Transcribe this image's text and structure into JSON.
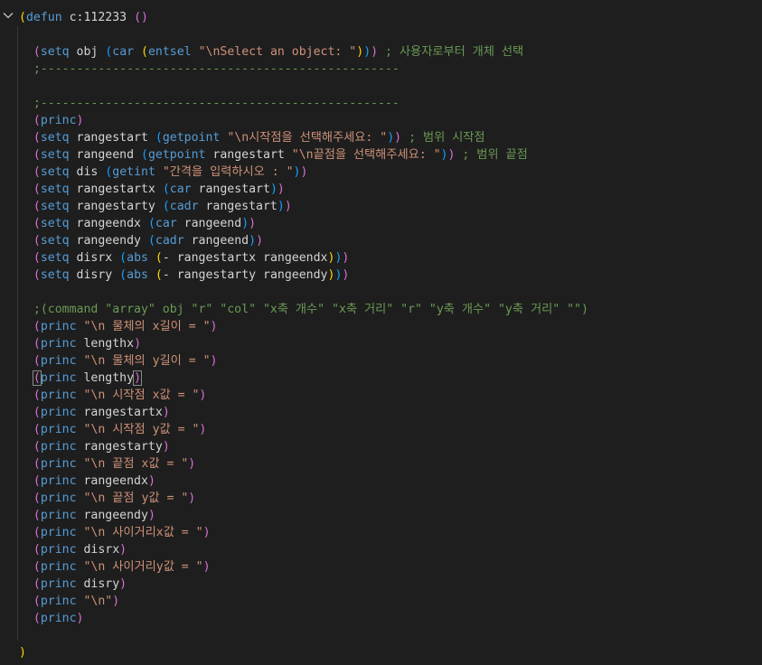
{
  "editor": {
    "fold_icon": "chevron-down-icon",
    "lines": [
      {
        "segs": [
          {
            "t": "(",
            "c": "p1"
          },
          {
            "t": "defun",
            "c": "k-fn"
          },
          {
            "t": " c:112233 ",
            "c": "var"
          },
          {
            "t": "()",
            "c": "p2"
          }
        ]
      },
      {
        "segs": []
      },
      {
        "segs": [
          {
            "t": "  (",
            "c": "p2"
          },
          {
            "t": "setq",
            "c": "k-fn"
          },
          {
            "t": " obj ",
            "c": "var"
          },
          {
            "t": "(",
            "c": "p3"
          },
          {
            "t": "car",
            "c": "k-fn"
          },
          {
            "t": " ",
            "c": "var"
          },
          {
            "t": "(",
            "c": "p1"
          },
          {
            "t": "entsel",
            "c": "k-fn"
          },
          {
            "t": " ",
            "c": "var"
          },
          {
            "t": "\"\\nSelect an object: \"",
            "c": "str"
          },
          {
            "t": ")",
            "c": "p1"
          },
          {
            "t": ")",
            "c": "p3"
          },
          {
            "t": ")",
            "c": "p2"
          },
          {
            "t": " ; 사용자로부터 개체 선택",
            "c": "cmt"
          }
        ]
      },
      {
        "segs": [
          {
            "t": "  ;--------------------------------------------------",
            "c": "cmt"
          }
        ]
      },
      {
        "segs": []
      },
      {
        "segs": [
          {
            "t": "  ;--------------------------------------------------",
            "c": "cmt"
          }
        ]
      },
      {
        "segs": [
          {
            "t": "  (",
            "c": "p2"
          },
          {
            "t": "princ",
            "c": "k-fn"
          },
          {
            "t": ")",
            "c": "p2"
          }
        ]
      },
      {
        "segs": [
          {
            "t": "  (",
            "c": "p2"
          },
          {
            "t": "setq",
            "c": "k-fn"
          },
          {
            "t": " rangestart ",
            "c": "var"
          },
          {
            "t": "(",
            "c": "p3"
          },
          {
            "t": "getpoint",
            "c": "k-fn"
          },
          {
            "t": " ",
            "c": "var"
          },
          {
            "t": "\"\\n시작점을 선택해주세요: \"",
            "c": "str"
          },
          {
            "t": ")",
            "c": "p3"
          },
          {
            "t": ")",
            "c": "p2"
          },
          {
            "t": " ; 범위 시작점",
            "c": "cmt"
          }
        ]
      },
      {
        "segs": [
          {
            "t": "  (",
            "c": "p2"
          },
          {
            "t": "setq",
            "c": "k-fn"
          },
          {
            "t": " rangeend ",
            "c": "var"
          },
          {
            "t": "(",
            "c": "p3"
          },
          {
            "t": "getpoint",
            "c": "k-fn"
          },
          {
            "t": " rangestart ",
            "c": "var"
          },
          {
            "t": "\"\\n끝점을 선택해주세요: \"",
            "c": "str"
          },
          {
            "t": ")",
            "c": "p3"
          },
          {
            "t": ")",
            "c": "p2"
          },
          {
            "t": " ; 범위 끝점",
            "c": "cmt"
          }
        ]
      },
      {
        "segs": [
          {
            "t": "  (",
            "c": "p2"
          },
          {
            "t": "setq",
            "c": "k-fn"
          },
          {
            "t": " dis ",
            "c": "var"
          },
          {
            "t": "(",
            "c": "p3"
          },
          {
            "t": "getint",
            "c": "k-fn"
          },
          {
            "t": " ",
            "c": "var"
          },
          {
            "t": "\"간격을 입력하시오 : \"",
            "c": "str"
          },
          {
            "t": ")",
            "c": "p3"
          },
          {
            "t": ")",
            "c": "p2"
          }
        ]
      },
      {
        "segs": [
          {
            "t": "  (",
            "c": "p2"
          },
          {
            "t": "setq",
            "c": "k-fn"
          },
          {
            "t": " rangestartx ",
            "c": "var"
          },
          {
            "t": "(",
            "c": "p3"
          },
          {
            "t": "car",
            "c": "k-fn"
          },
          {
            "t": " rangestart",
            "c": "var"
          },
          {
            "t": ")",
            "c": "p3"
          },
          {
            "t": ")",
            "c": "p2"
          }
        ]
      },
      {
        "segs": [
          {
            "t": "  (",
            "c": "p2"
          },
          {
            "t": "setq",
            "c": "k-fn"
          },
          {
            "t": " rangestarty ",
            "c": "var"
          },
          {
            "t": "(",
            "c": "p3"
          },
          {
            "t": "cadr",
            "c": "k-fn"
          },
          {
            "t": " rangestart",
            "c": "var"
          },
          {
            "t": ")",
            "c": "p3"
          },
          {
            "t": ")",
            "c": "p2"
          }
        ]
      },
      {
        "segs": [
          {
            "t": "  (",
            "c": "p2"
          },
          {
            "t": "setq",
            "c": "k-fn"
          },
          {
            "t": " rangeendx ",
            "c": "var"
          },
          {
            "t": "(",
            "c": "p3"
          },
          {
            "t": "car",
            "c": "k-fn"
          },
          {
            "t": " rangeend",
            "c": "var"
          },
          {
            "t": ")",
            "c": "p3"
          },
          {
            "t": ")",
            "c": "p2"
          }
        ]
      },
      {
        "segs": [
          {
            "t": "  (",
            "c": "p2"
          },
          {
            "t": "setq",
            "c": "k-fn"
          },
          {
            "t": " rangeendy ",
            "c": "var"
          },
          {
            "t": "(",
            "c": "p3"
          },
          {
            "t": "cadr",
            "c": "k-fn"
          },
          {
            "t": " rangeend",
            "c": "var"
          },
          {
            "t": ")",
            "c": "p3"
          },
          {
            "t": ")",
            "c": "p2"
          }
        ]
      },
      {
        "segs": [
          {
            "t": "  (",
            "c": "p2"
          },
          {
            "t": "setq",
            "c": "k-fn"
          },
          {
            "t": " disrx ",
            "c": "var"
          },
          {
            "t": "(",
            "c": "p3"
          },
          {
            "t": "abs",
            "c": "k-fn"
          },
          {
            "t": " ",
            "c": "var"
          },
          {
            "t": "(",
            "c": "p1"
          },
          {
            "t": "- rangestartx rangeendx",
            "c": "var"
          },
          {
            "t": ")",
            "c": "p1"
          },
          {
            "t": ")",
            "c": "p3"
          },
          {
            "t": ")",
            "c": "p2"
          }
        ]
      },
      {
        "segs": [
          {
            "t": "  (",
            "c": "p2"
          },
          {
            "t": "setq",
            "c": "k-fn"
          },
          {
            "t": " disry ",
            "c": "var"
          },
          {
            "t": "(",
            "c": "p3"
          },
          {
            "t": "abs",
            "c": "k-fn"
          },
          {
            "t": " ",
            "c": "var"
          },
          {
            "t": "(",
            "c": "p1"
          },
          {
            "t": "- rangestarty rangeendy",
            "c": "var"
          },
          {
            "t": ")",
            "c": "p1"
          },
          {
            "t": ")",
            "c": "p3"
          },
          {
            "t": ")",
            "c": "p2"
          }
        ]
      },
      {
        "segs": []
      },
      {
        "segs": [
          {
            "t": "  ;(command \"array\" obj \"r\" \"col\" \"x축 개수\" \"x축 거리\" \"r\" \"y축 개수\" \"y축 거리\" \"\")",
            "c": "cmt"
          }
        ]
      },
      {
        "segs": [
          {
            "t": "  (",
            "c": "p2"
          },
          {
            "t": "princ",
            "c": "k-fn"
          },
          {
            "t": " ",
            "c": "var"
          },
          {
            "t": "\"\\n 물체의 x길이 = \"",
            "c": "str"
          },
          {
            "t": ")",
            "c": "p2"
          }
        ]
      },
      {
        "segs": [
          {
            "t": "  (",
            "c": "p2"
          },
          {
            "t": "princ",
            "c": "k-fn"
          },
          {
            "t": " lengthx",
            "c": "var"
          },
          {
            "t": ")",
            "c": "p2"
          }
        ]
      },
      {
        "segs": [
          {
            "t": "  (",
            "c": "p2"
          },
          {
            "t": "princ",
            "c": "k-fn"
          },
          {
            "t": " ",
            "c": "var"
          },
          {
            "t": "\"\\n 물체의 y길이 = \"",
            "c": "str"
          },
          {
            "t": ")",
            "c": "p2"
          }
        ]
      },
      {
        "segs": [
          {
            "t": "  ",
            "c": "var"
          },
          {
            "t": "(",
            "c": "p2",
            "box": true
          },
          {
            "t": "princ",
            "c": "k-fn"
          },
          {
            "t": " lengthy",
            "c": "var"
          },
          {
            "t": ")",
            "c": "p2",
            "box": true
          }
        ]
      },
      {
        "segs": [
          {
            "t": "  (",
            "c": "p2"
          },
          {
            "t": "princ",
            "c": "k-fn"
          },
          {
            "t": " ",
            "c": "var"
          },
          {
            "t": "\"\\n 시작점 x값 = \"",
            "c": "str"
          },
          {
            "t": ")",
            "c": "p2"
          }
        ]
      },
      {
        "segs": [
          {
            "t": "  (",
            "c": "p2"
          },
          {
            "t": "princ",
            "c": "k-fn"
          },
          {
            "t": " rangestartx",
            "c": "var"
          },
          {
            "t": ")",
            "c": "p2"
          }
        ]
      },
      {
        "segs": [
          {
            "t": "  (",
            "c": "p2"
          },
          {
            "t": "princ",
            "c": "k-fn"
          },
          {
            "t": " ",
            "c": "var"
          },
          {
            "t": "\"\\n 시작점 y값 = \"",
            "c": "str"
          },
          {
            "t": ")",
            "c": "p2"
          }
        ]
      },
      {
        "segs": [
          {
            "t": "  (",
            "c": "p2"
          },
          {
            "t": "princ",
            "c": "k-fn"
          },
          {
            "t": " rangestarty",
            "c": "var"
          },
          {
            "t": ")",
            "c": "p2"
          }
        ]
      },
      {
        "segs": [
          {
            "t": "  (",
            "c": "p2"
          },
          {
            "t": "princ",
            "c": "k-fn"
          },
          {
            "t": " ",
            "c": "var"
          },
          {
            "t": "\"\\n 끝점 x값 = \"",
            "c": "str"
          },
          {
            "t": ")",
            "c": "p2"
          }
        ]
      },
      {
        "segs": [
          {
            "t": "  (",
            "c": "p2"
          },
          {
            "t": "princ",
            "c": "k-fn"
          },
          {
            "t": " rangeendx",
            "c": "var"
          },
          {
            "t": ")",
            "c": "p2"
          }
        ]
      },
      {
        "segs": [
          {
            "t": "  (",
            "c": "p2"
          },
          {
            "t": "princ",
            "c": "k-fn"
          },
          {
            "t": " ",
            "c": "var"
          },
          {
            "t": "\"\\n 끝점 y값 = \"",
            "c": "str"
          },
          {
            "t": ")",
            "c": "p2"
          }
        ]
      },
      {
        "segs": [
          {
            "t": "  (",
            "c": "p2"
          },
          {
            "t": "princ",
            "c": "k-fn"
          },
          {
            "t": " rangeendy",
            "c": "var"
          },
          {
            "t": ")",
            "c": "p2"
          }
        ]
      },
      {
        "segs": [
          {
            "t": "  (",
            "c": "p2"
          },
          {
            "t": "princ",
            "c": "k-fn"
          },
          {
            "t": " ",
            "c": "var"
          },
          {
            "t": "\"\\n 사이거리x값 = \"",
            "c": "str"
          },
          {
            "t": ")",
            "c": "p2"
          }
        ]
      },
      {
        "segs": [
          {
            "t": "  (",
            "c": "p2"
          },
          {
            "t": "princ",
            "c": "k-fn"
          },
          {
            "t": " disrx",
            "c": "var"
          },
          {
            "t": ")",
            "c": "p2"
          }
        ]
      },
      {
        "segs": [
          {
            "t": "  (",
            "c": "p2"
          },
          {
            "t": "princ",
            "c": "k-fn"
          },
          {
            "t": " ",
            "c": "var"
          },
          {
            "t": "\"\\n 사이거리y값 = \"",
            "c": "str"
          },
          {
            "t": ")",
            "c": "p2"
          }
        ]
      },
      {
        "segs": [
          {
            "t": "  (",
            "c": "p2"
          },
          {
            "t": "princ",
            "c": "k-fn"
          },
          {
            "t": " disry",
            "c": "var"
          },
          {
            "t": ")",
            "c": "p2"
          }
        ]
      },
      {
        "segs": [
          {
            "t": "  (",
            "c": "p2"
          },
          {
            "t": "princ",
            "c": "k-fn"
          },
          {
            "t": " ",
            "c": "var"
          },
          {
            "t": "\"\\n\"",
            "c": "str"
          },
          {
            "t": ")",
            "c": "p2"
          }
        ]
      },
      {
        "segs": [
          {
            "t": "  (",
            "c": "p2"
          },
          {
            "t": "princ",
            "c": "k-fn"
          },
          {
            "t": ")",
            "c": "p2"
          }
        ]
      },
      {
        "segs": []
      },
      {
        "segs": [
          {
            "t": ")",
            "c": "p1"
          }
        ]
      }
    ]
  }
}
